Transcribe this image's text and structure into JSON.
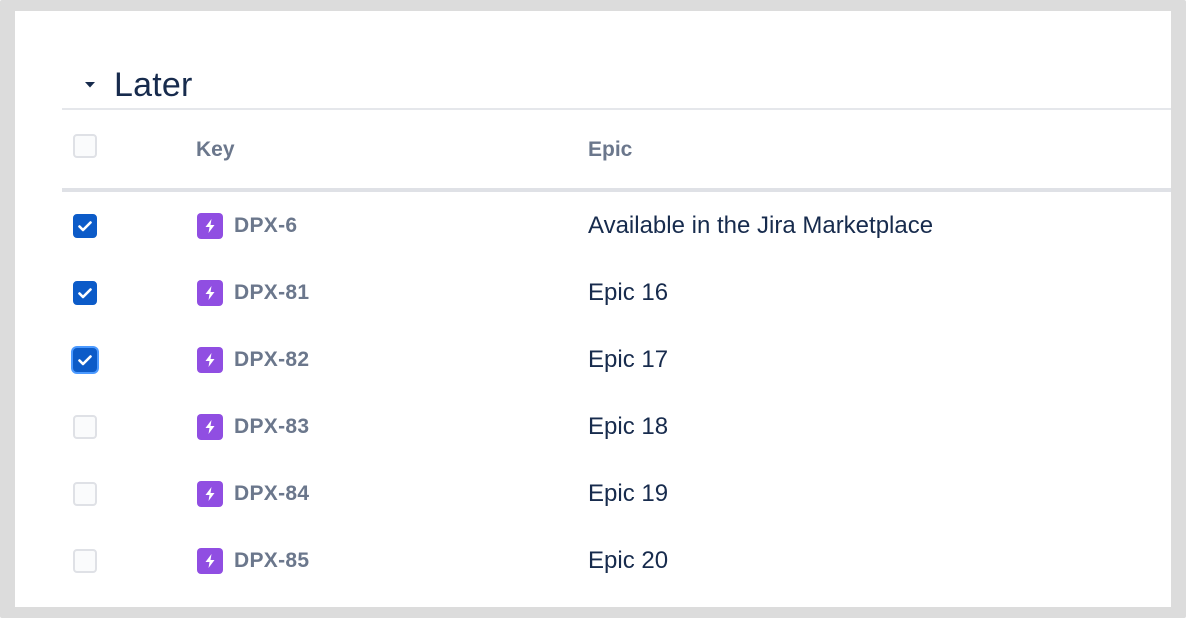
{
  "section": {
    "title": "Later",
    "expanded": true
  },
  "table": {
    "columns": {
      "key": "Key",
      "epic": "Epic"
    },
    "header_checkbox_checked": false,
    "rows": [
      {
        "key": "DPX-6",
        "epic": "Available in the Jira Marketplace",
        "checked": true,
        "focused": false
      },
      {
        "key": "DPX-81",
        "epic": "Epic 16",
        "checked": true,
        "focused": false
      },
      {
        "key": "DPX-82",
        "epic": "Epic 17",
        "checked": true,
        "focused": true
      },
      {
        "key": "DPX-83",
        "epic": "Epic 18",
        "checked": false,
        "focused": false
      },
      {
        "key": "DPX-84",
        "epic": "Epic 19",
        "checked": false,
        "focused": false
      },
      {
        "key": "DPX-85",
        "epic": "Epic 20",
        "checked": false,
        "focused": false
      }
    ]
  },
  "icons": {
    "caret": "caret-down-icon",
    "epic": "lightning-icon",
    "check": "checkmark-icon"
  },
  "colors": {
    "checkbox_checked": "#0c5bc8",
    "epic_icon": "#904ee2",
    "focus_ring": "#4c9aff",
    "text_primary": "#172b4d",
    "text_secondary": "#6b778c"
  }
}
